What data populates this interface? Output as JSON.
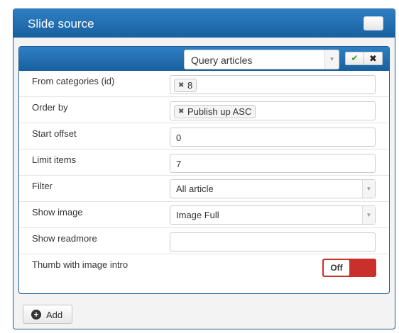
{
  "panel": {
    "title": "Slide source"
  },
  "source": {
    "selected": "Query articles",
    "ok_icon": "check-icon",
    "cancel_icon": "close-icon"
  },
  "fields": {
    "from_categories": {
      "label": "From categories (id)",
      "tag": "8"
    },
    "order_by": {
      "label": "Order by",
      "tag": "Publish up ASC"
    },
    "start_offset": {
      "label": "Start offset",
      "value": "0"
    },
    "limit_items": {
      "label": "Limit items",
      "value": "7"
    },
    "filter": {
      "label": "Filter",
      "selected": "All article"
    },
    "show_image": {
      "label": "Show image",
      "selected": "Image Full"
    },
    "show_readmore": {
      "label": "Show readmore",
      "value": ""
    },
    "thumb_intro": {
      "label": "Thumb with image intro",
      "state": "Off"
    }
  },
  "add_button": {
    "label": "Add"
  },
  "colors": {
    "header_blue": "#1f6aaf",
    "toggle_off": "#c9302c",
    "ok_green": "#3a9a27"
  }
}
